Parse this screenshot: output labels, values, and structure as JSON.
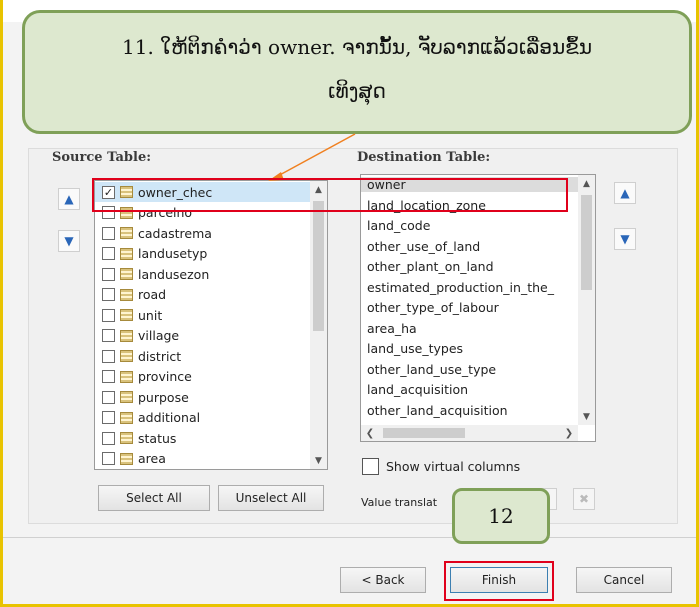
{
  "instruction": {
    "line1": "11. ໃຫ້ຕິກຄຳວ່າ owner. ຈາກນັ້ນ, ຈັບລາກແລ້ວເລື່ອນຂຶ້ນ",
    "line2": "ເທິງສຸດ"
  },
  "step_badge": "12",
  "source": {
    "label": "Source Table:",
    "items": [
      {
        "name": "owner_chec",
        "checked": true
      },
      {
        "name": "parcelno",
        "checked": false
      },
      {
        "name": "cadastrema",
        "checked": false
      },
      {
        "name": "landusetyp",
        "checked": false
      },
      {
        "name": "landusezon",
        "checked": false
      },
      {
        "name": "road",
        "checked": false
      },
      {
        "name": "unit",
        "checked": false
      },
      {
        "name": "village",
        "checked": false
      },
      {
        "name": "district",
        "checked": false
      },
      {
        "name": "province",
        "checked": false
      },
      {
        "name": "purpose",
        "checked": false
      },
      {
        "name": "additional",
        "checked": false
      },
      {
        "name": "status",
        "checked": false
      },
      {
        "name": "area",
        "checked": false
      }
    ],
    "select_all": "Select All",
    "unselect_all": "Unselect All"
  },
  "destination": {
    "label": "Destination Table:",
    "items": [
      "owner",
      "land_location_zone",
      "land_code",
      "other_use_of_land",
      "other_plant_on_land",
      "estimated_production_in_the_",
      "other_type_of_labour",
      "area_ha",
      "land_use_types",
      "other_land_use_type",
      "land_acquisition",
      "other_land_acquisition"
    ]
  },
  "show_virtual_columns": "Show virtual columns",
  "value_translate": "Value translat",
  "footer": {
    "back": "< Back",
    "finish": "Finish",
    "cancel": "Cancel"
  },
  "colors": {
    "highlight_red": "#e0001b",
    "callout_fill": "#dde8cf",
    "callout_border": "#7fa058",
    "frame_yellow": "#e8c300"
  }
}
